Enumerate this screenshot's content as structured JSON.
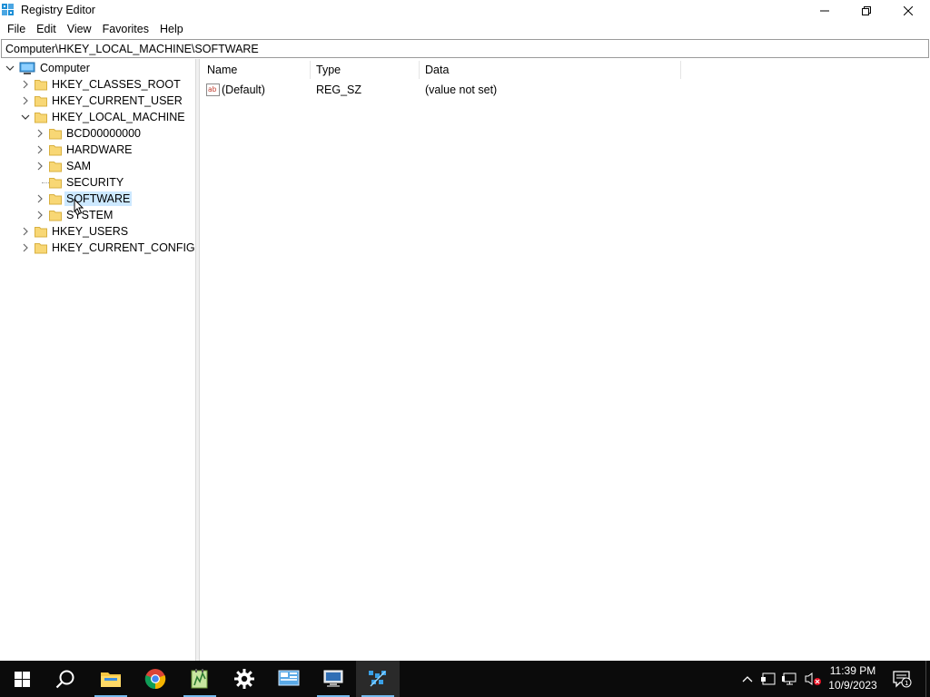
{
  "window": {
    "title": "Registry Editor"
  },
  "menu": [
    {
      "label": "File"
    },
    {
      "label": "Edit"
    },
    {
      "label": "View"
    },
    {
      "label": "Favorites"
    },
    {
      "label": "Help"
    }
  ],
  "address": {
    "value": "Computer\\HKEY_LOCAL_MACHINE\\SOFTWARE"
  },
  "tree": {
    "root": "Computer",
    "hives": {
      "classes_root": "HKEY_CLASSES_ROOT",
      "current_user": "HKEY_CURRENT_USER",
      "local_machine": "HKEY_LOCAL_MACHINE",
      "users": "HKEY_USERS",
      "current_config": "HKEY_CURRENT_CONFIG"
    },
    "local_machine_children": {
      "bcd": "BCD00000000",
      "hardware": "HARDWARE",
      "sam": "SAM",
      "security": "SECURITY",
      "software": "SOFTWARE",
      "system": "SYSTEM"
    },
    "selected": "SOFTWARE"
  },
  "list": {
    "columns": {
      "name": "Name",
      "type": "Type",
      "data": "Data"
    },
    "rows": [
      {
        "name": "(Default)",
        "type": "REG_SZ",
        "data": "(value not set)",
        "icon": "string-value-icon"
      }
    ]
  },
  "taskbar": {
    "apps": [
      "start",
      "search",
      "file-explorer",
      "chrome",
      "notepad-plus",
      "settings",
      "control-panel",
      "remote-desktop",
      "registry-editor"
    ],
    "active_app": "registry-editor",
    "clock": {
      "time": "11:39 PM",
      "date": "10/9/2023"
    },
    "notification_count": "1"
  },
  "colors": {
    "selection": "#cce8ff",
    "taskbar_bg": "#0b0b0b",
    "accent": "#76b9ed"
  }
}
